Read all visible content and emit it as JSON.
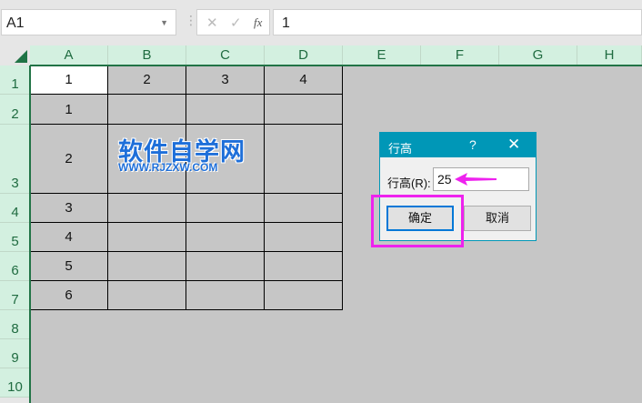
{
  "name_box": {
    "value": "A1"
  },
  "formula_bar": {
    "cancel": "✕",
    "enter": "✓",
    "fx": "fx",
    "value": "1"
  },
  "columns": [
    "A",
    "B",
    "C",
    "D",
    "E",
    "F",
    "G",
    "H"
  ],
  "rows": [
    "1",
    "2",
    "3",
    "4",
    "5",
    "6",
    "7",
    "8",
    "9",
    "10"
  ],
  "cells": {
    "row1": [
      "1",
      "2",
      "3",
      "4"
    ],
    "colA": [
      "1",
      "2",
      "3",
      "4",
      "5",
      "6"
    ]
  },
  "watermark": {
    "title": "软件自学网",
    "url": "WWW.RJZXW.COM"
  },
  "dialog": {
    "title": "行高",
    "help": "?",
    "close": "✕",
    "label": "行高(R):",
    "value": "25",
    "ok": "确定",
    "cancel": "取消"
  },
  "colors": {
    "accent": "#217346",
    "dialog_title": "#0097b7",
    "highlight": "#ee22ee"
  }
}
